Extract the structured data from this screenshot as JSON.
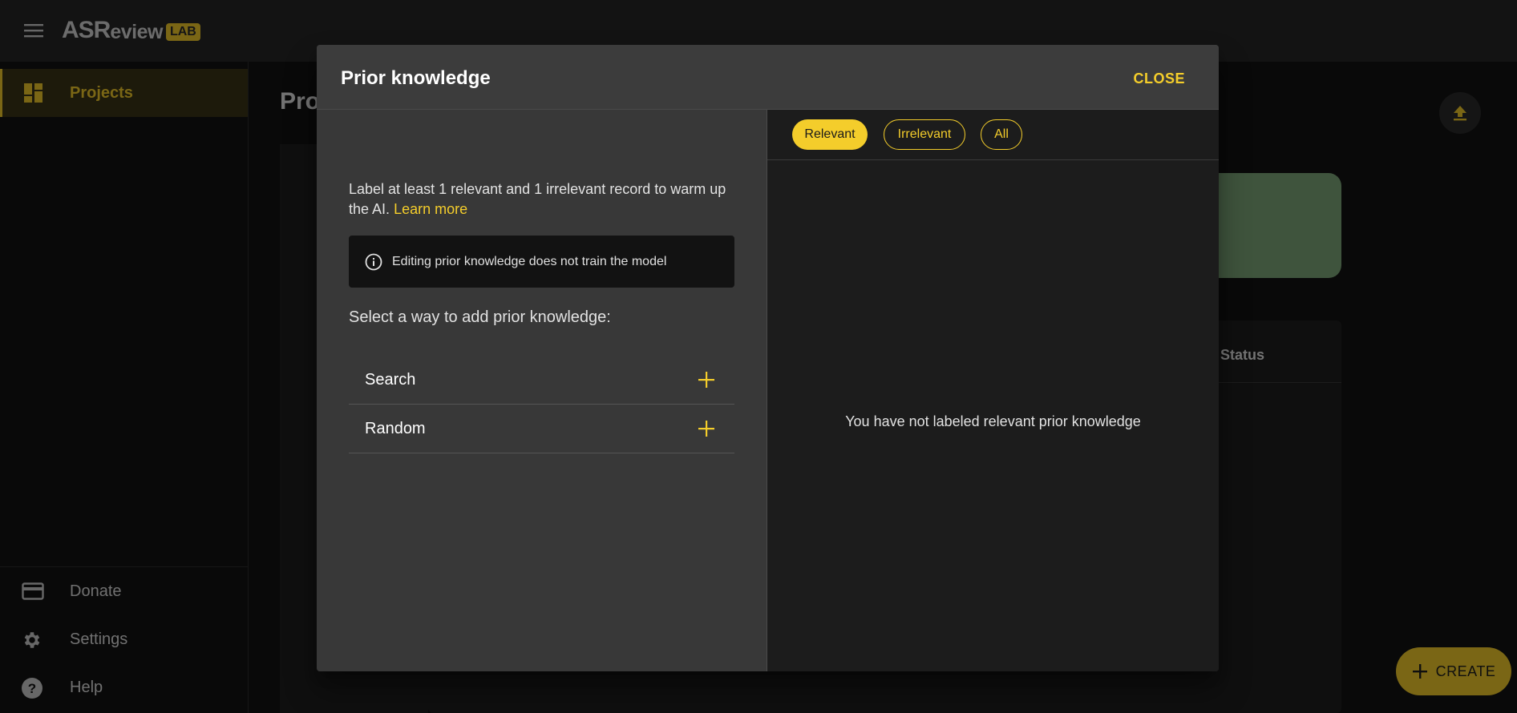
{
  "app": {
    "logo_main": "ASR",
    "logo_sub": "eview",
    "logo_badge": "LAB"
  },
  "sidebar": {
    "items": [
      {
        "label": "Projects",
        "icon": "dashboard-icon",
        "active": true
      },
      {
        "label": "Donate",
        "icon": "credit-card-icon"
      },
      {
        "label": "Settings",
        "icon": "gear-icon"
      },
      {
        "label": "Help",
        "icon": "help-circle-icon"
      }
    ]
  },
  "main": {
    "title_partial": "Pro",
    "table_status_header": "Status",
    "create_label": "CREATE"
  },
  "dialog": {
    "title": "Prior knowledge",
    "close_label": "CLOSE",
    "intro_text": "Label at least 1 relevant and 1 irrelevant record to warm up the AI.",
    "learn_more": "Learn more",
    "info_text": "Editing prior knowledge does not train the model",
    "select_prompt": "Select a way to add prior knowledge:",
    "methods": [
      {
        "label": "Search"
      },
      {
        "label": "Random"
      }
    ],
    "filters": [
      {
        "label": "Relevant",
        "selected": true
      },
      {
        "label": "Irrelevant",
        "selected": false
      },
      {
        "label": "All",
        "selected": false
      }
    ],
    "empty_message": "You have not labeled relevant prior knowledge"
  },
  "colors": {
    "accent": "#f4cd2b",
    "dialog_bg": "#383838",
    "panel_dark": "#1c1c1c"
  }
}
